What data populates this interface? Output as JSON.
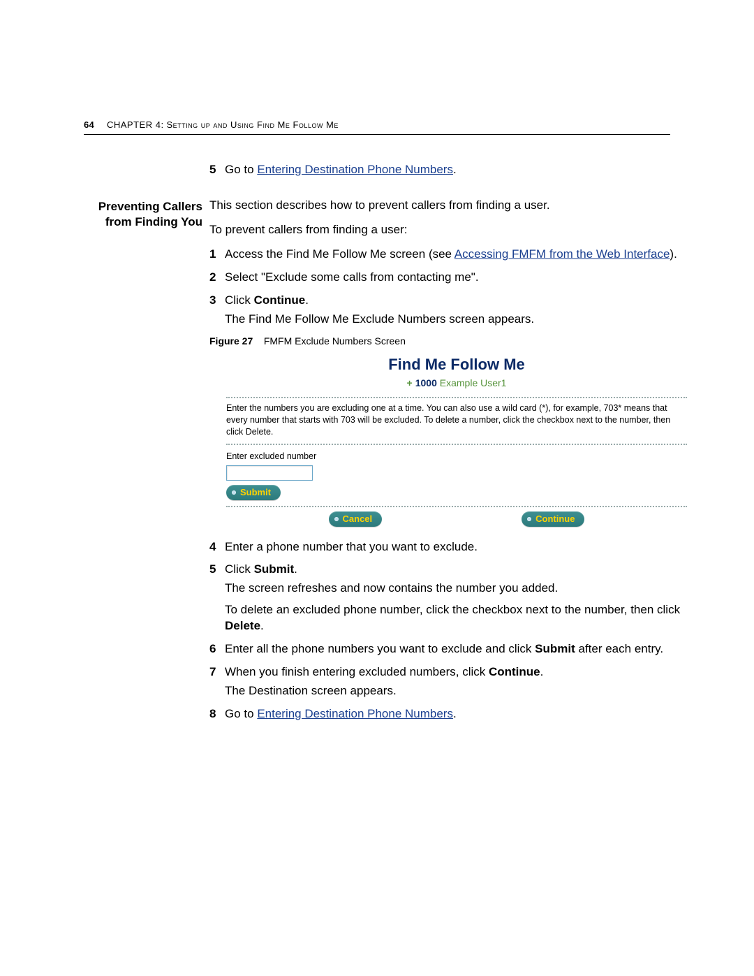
{
  "header": {
    "page_number": "64",
    "chapter_label": "Chapter 4:",
    "chapter_title": "Setting up and Using Find Me Follow Me"
  },
  "top_step": {
    "num": "5",
    "lead": "Go to ",
    "link": "Entering Destination Phone Numbers",
    "tail": "."
  },
  "section": {
    "margin_title_line1": "Preventing Callers",
    "margin_title_line2": "from Finding You",
    "intro1": "This section describes how to prevent callers from finding a user.",
    "intro2": "To prevent callers from finding a user:",
    "steps_a": [
      {
        "num": "1",
        "text_lead": "Access the Find Me Follow Me screen (see ",
        "link": "Accessing FMFM from the Web Interface",
        "text_tail": ")."
      },
      {
        "num": "2",
        "text": "Select \"Exclude some calls from contacting me\"."
      },
      {
        "num": "3",
        "text_lead": "Click ",
        "bold": "Continue",
        "text_tail": ".",
        "para": "The Find Me Follow Me Exclude Numbers screen appears."
      }
    ],
    "fig": {
      "label": "Figure 27",
      "caption": "FMFM Exclude Numbers Screen"
    },
    "steps_b": [
      {
        "num": "4",
        "text": "Enter a phone number that you want to exclude."
      },
      {
        "num": "5",
        "text_lead": "Click ",
        "bold": "Submit",
        "text_tail": ".",
        "para1": "The screen refreshes and now contains the number you added.",
        "para2_lead": "To delete an excluded phone number, click the checkbox next to the number, then click ",
        "para2_bold": "Delete",
        "para2_tail": "."
      },
      {
        "num": "6",
        "text_lead": "Enter all the phone numbers you want to exclude and click ",
        "bold": "Submit",
        "text_tail": " after each entry."
      },
      {
        "num": "7",
        "text_lead": "When you finish entering excluded numbers, click ",
        "bold": "Continue",
        "text_tail": ".",
        "para": "The Destination screen appears."
      },
      {
        "num": "8",
        "text_lead": "Go to ",
        "link": "Entering Destination Phone Numbers",
        "text_tail": "."
      }
    ]
  },
  "shot": {
    "title": "Find Me Follow Me",
    "ext": "1000",
    "user": "Example User1",
    "help": "Enter the numbers you are excluding one at a time. You can also use a wild card (*), for example, 703* means that every number that starts with 703 will be excluded. To delete a number, click the checkbox next to the number, then click Delete.",
    "input_label": "Enter excluded number",
    "input_value": "",
    "btn_submit": "Submit",
    "btn_cancel": "Cancel",
    "btn_continue": "Continue"
  }
}
